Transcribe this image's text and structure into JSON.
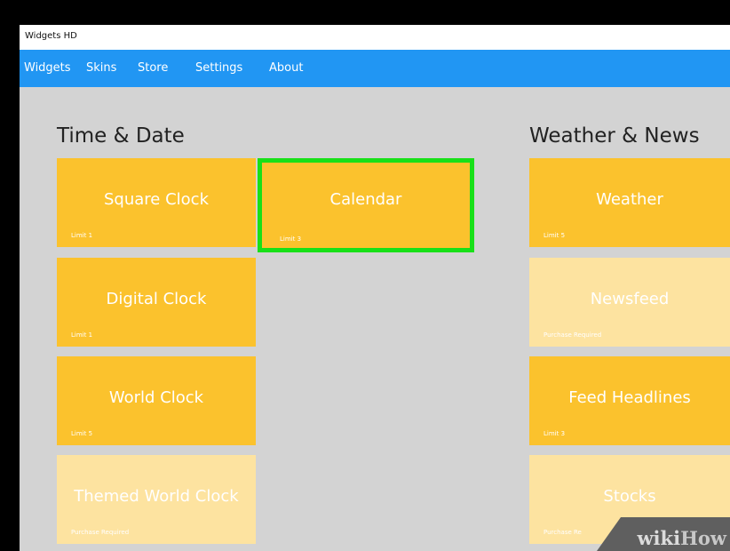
{
  "app": {
    "title": "Widgets HD"
  },
  "nav": {
    "items": [
      {
        "label": "Widgets"
      },
      {
        "label": "Skins"
      },
      {
        "label": "Store"
      },
      {
        "label": "Settings"
      },
      {
        "label": "About"
      }
    ]
  },
  "sections": [
    {
      "title": "Time & Date",
      "tiles": [
        {
          "name": "Square Clock",
          "status": "Limit 1",
          "available": true
        },
        {
          "name": "Calendar",
          "status": "Limit 3",
          "available": true,
          "selected": true
        },
        {
          "name": "Digital Clock",
          "status": "Limit 1",
          "available": true
        },
        {
          "name": "World Clock",
          "status": "Limit 5",
          "available": true
        },
        {
          "name": "Themed World Clock",
          "status": "Purchase Required",
          "available": false
        }
      ]
    },
    {
      "title": "Weather & News",
      "tiles": [
        {
          "name": "Weather",
          "status": "Limit 5",
          "available": true
        },
        {
          "name": "Newsfeed",
          "status": "Purchase Required",
          "available": false
        },
        {
          "name": "Feed Headlines",
          "status": "Limit 3",
          "available": true
        },
        {
          "name": "Stocks",
          "status": "Purchase Re",
          "available": false
        }
      ]
    }
  ],
  "watermark": {
    "part1": "wiki",
    "part2": "How"
  },
  "colors": {
    "nav": "#2196f3",
    "tile": "#fbc22d",
    "tile_disabled": "#fde3a0",
    "highlight": "#18e018",
    "background": "#d3d3d3"
  }
}
